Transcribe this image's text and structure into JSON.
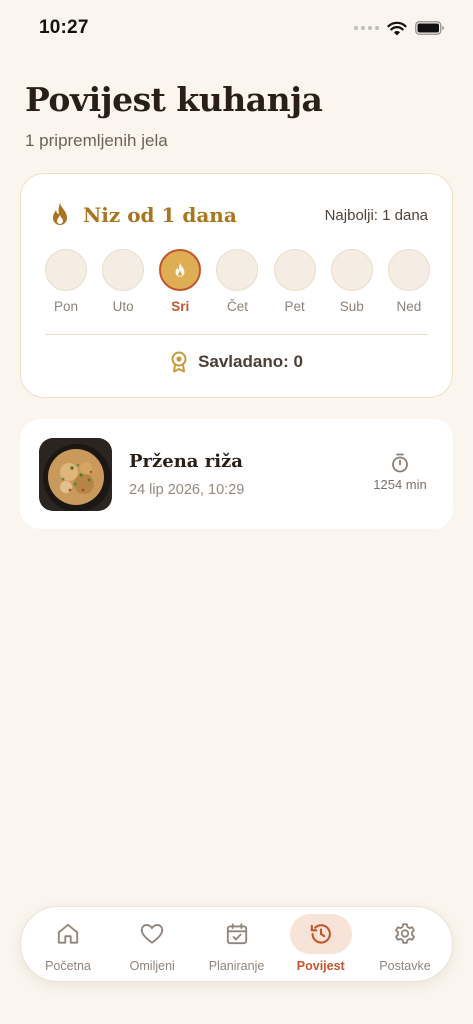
{
  "status_bar": {
    "time": "10:27"
  },
  "header": {
    "title": "Povijest kuhanja",
    "subtitle": "1 pripremljenih jela"
  },
  "streak": {
    "title": "Niz od 1 dana",
    "best": "Najbolji: 1 dana",
    "days": [
      {
        "label": "Pon",
        "active": false
      },
      {
        "label": "Uto",
        "active": false
      },
      {
        "label": "Sri",
        "active": true
      },
      {
        "label": "Čet",
        "active": false
      },
      {
        "label": "Pet",
        "active": false
      },
      {
        "label": "Sub",
        "active": false
      },
      {
        "label": "Ned",
        "active": false
      }
    ],
    "mastered": "Savladano: 0"
  },
  "history": [
    {
      "title": "Pržena riža",
      "date": "24 lip 2026, 10:29",
      "duration": "1254 min",
      "icon": "stopwatch-icon"
    }
  ],
  "tab_bar": {
    "tabs": [
      {
        "label": "Početna",
        "icon": "home-icon",
        "active": false
      },
      {
        "label": "Omiljeni",
        "icon": "heart-icon",
        "active": false
      },
      {
        "label": "Planiranje",
        "icon": "calendar-check-icon",
        "active": false
      },
      {
        "label": "Povijest",
        "icon": "history-icon",
        "active": true
      },
      {
        "label": "Postavke",
        "icon": "gear-icon",
        "active": false
      }
    ]
  },
  "colors": {
    "background": "#faf5ef",
    "accent": "#c4552b",
    "streak_gold": "#a9761f",
    "active_day_fill": "#deae55"
  }
}
